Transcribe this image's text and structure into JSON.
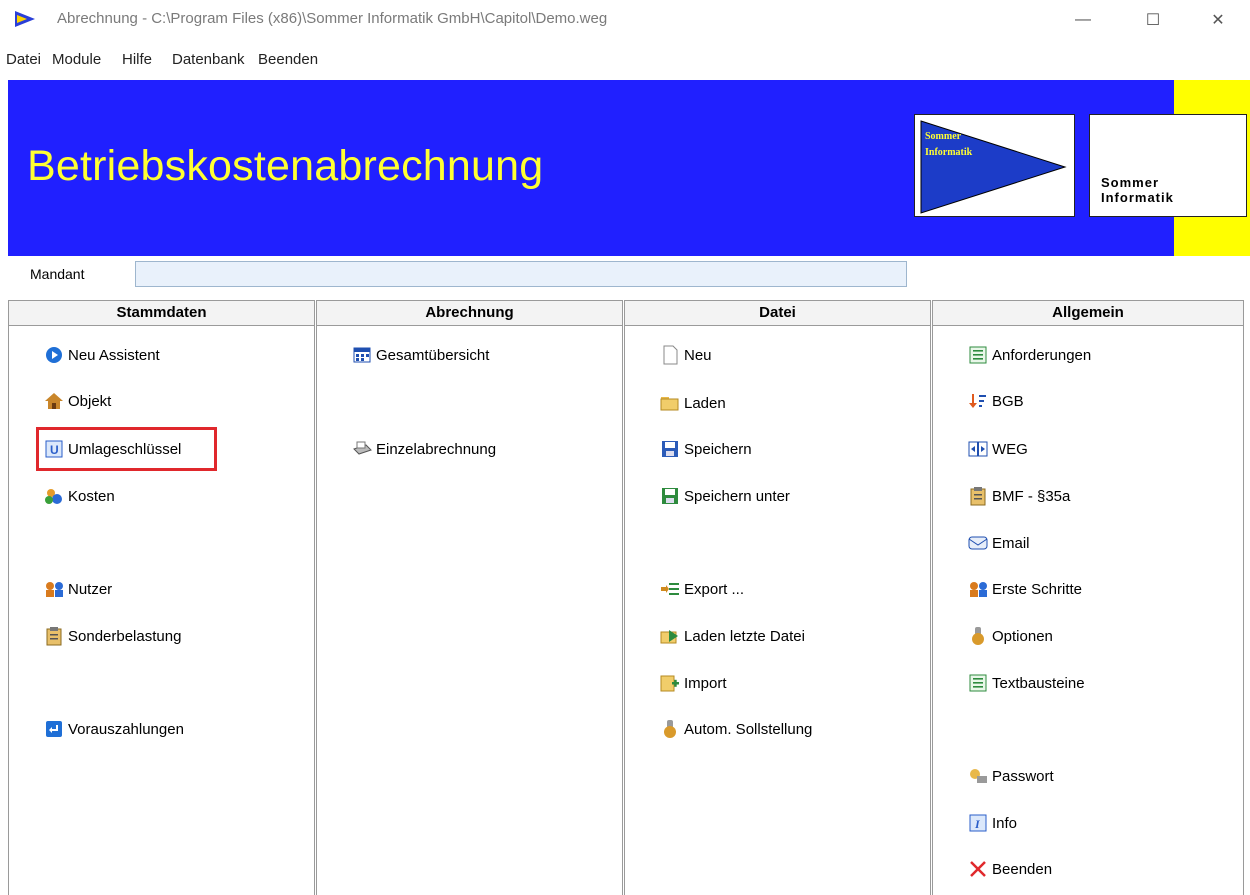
{
  "window": {
    "title": "Abrechnung - C:\\Program Files (x86)\\Sommer Informatik GmbH\\Capitol\\Demo.weg",
    "minimize": "—",
    "maximize": "☐",
    "close": "✕"
  },
  "menu": [
    "Datei",
    "Module",
    "Hilfe",
    "Datenbank",
    "Beenden"
  ],
  "banner": {
    "title": "Betriebskostenabrechnung",
    "logo_left_line1": "Sommer",
    "logo_left_line2": "Informatik",
    "logo_right_line1": "Sommer",
    "logo_right_line2": "Informatik",
    "background_color": "#2020ff",
    "accent_color": "#ffff00"
  },
  "mandant": {
    "label": "Mandant",
    "value": ""
  },
  "columns": {
    "stammdaten": {
      "header": "Stammdaten",
      "items": [
        {
          "label": "Neu Assistent",
          "icon": "wizard-icon"
        },
        {
          "label": "Objekt",
          "icon": "house-icon"
        },
        {
          "label": "Umlageschlüssel",
          "icon": "key-u-icon"
        },
        {
          "label": "Kosten",
          "icon": "people-coins-icon"
        },
        {
          "label": "Nutzer",
          "icon": "users-icon"
        },
        {
          "label": "Sonderbelastung",
          "icon": "clipboard-icon"
        },
        {
          "label": "Vorauszahlungen",
          "icon": "return-icon"
        }
      ]
    },
    "abrechnung": {
      "header": "Abrechnung",
      "items": [
        {
          "label": "Gesamtübersicht",
          "icon": "grid-icon"
        },
        {
          "label": "Einzelabrechnung",
          "icon": "printer-icon"
        }
      ]
    },
    "datei": {
      "header": "Datei",
      "items": [
        {
          "label": "Neu",
          "icon": "new-file-icon"
        },
        {
          "label": "Laden",
          "icon": "folder-open-icon"
        },
        {
          "label": "Speichern",
          "icon": "save-icon"
        },
        {
          "label": "Speichern unter",
          "icon": "save-as-icon"
        },
        {
          "label": "Export ...",
          "icon": "export-icon"
        },
        {
          "label": "Laden letzte Datei",
          "icon": "load-last-icon"
        },
        {
          "label": "Import",
          "icon": "import-icon"
        },
        {
          "label": "Autom. Sollstellung",
          "icon": "auto-icon"
        }
      ]
    },
    "allgemein": {
      "header": "Allgemein",
      "items": [
        {
          "label": "Anforderungen",
          "icon": "list-icon"
        },
        {
          "label": "BGB",
          "icon": "sort-icon"
        },
        {
          "label": "WEG",
          "icon": "columns-icon"
        },
        {
          "label": "BMF - §35a",
          "icon": "clipboard-icon"
        },
        {
          "label": "Email",
          "icon": "envelope-icon"
        },
        {
          "label": "Erste Schritte",
          "icon": "users-icon"
        },
        {
          "label": "Optionen",
          "icon": "options-icon"
        },
        {
          "label": "Textbausteine",
          "icon": "text-icon"
        },
        {
          "label": "Passwort",
          "icon": "password-icon"
        },
        {
          "label": "Info",
          "icon": "info-icon"
        },
        {
          "label": "Beenden",
          "icon": "exit-icon"
        }
      ]
    }
  }
}
